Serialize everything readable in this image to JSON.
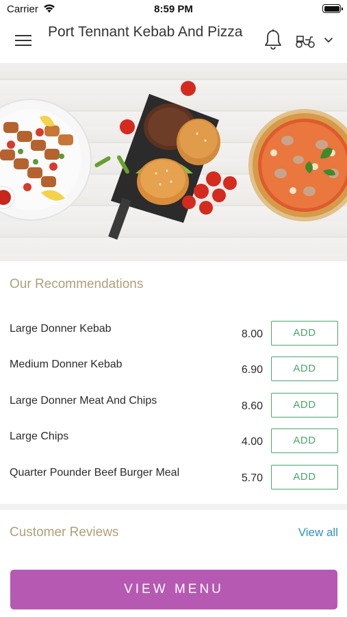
{
  "status_bar": {
    "carrier": "Carrier",
    "time": "8:59 PM"
  },
  "header": {
    "title": "Port Tennant Kebab And Pizza"
  },
  "recommendations": {
    "title": "Our Recommendations",
    "items": [
      {
        "name": "Large Donner Kebab",
        "price": "8.00",
        "add_label": "ADD"
      },
      {
        "name": "Medium Donner Kebab",
        "price": "6.90",
        "add_label": "ADD"
      },
      {
        "name": "Large Donner Meat And Chips",
        "price": "8.60",
        "add_label": "ADD"
      },
      {
        "name": "Large Chips",
        "price": "4.00",
        "add_label": "ADD"
      },
      {
        "name": "Quarter Pounder Beef Burger Meal",
        "price": "5.70",
        "add_label": "ADD"
      }
    ]
  },
  "reviews": {
    "title": "Customer Reviews",
    "view_all_label": "View all"
  },
  "footer": {
    "view_menu_label": "VIEW MENU"
  },
  "colors": {
    "accent_purple": "#b659b3",
    "add_green": "#4aa66a",
    "section_gold": "#b0a079",
    "link_blue": "#2c93bf"
  },
  "icons": [
    "wifi-icon",
    "battery-icon",
    "hamburger-menu-icon",
    "bell-icon",
    "scooter-icon",
    "chevron-down-icon"
  ]
}
